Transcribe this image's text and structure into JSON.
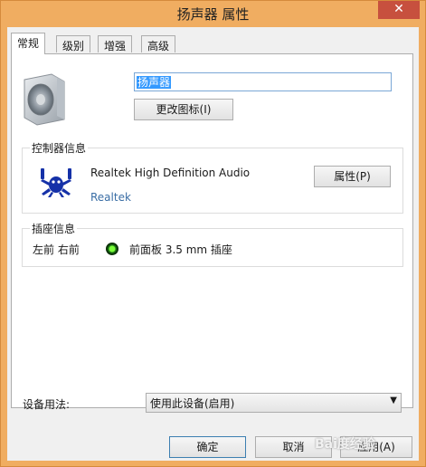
{
  "window": {
    "title": "扬声器 属性",
    "close_glyph": "✕"
  },
  "tabs": [
    {
      "label": "常规",
      "active": true
    },
    {
      "label": "级别",
      "active": false
    },
    {
      "label": "增强",
      "active": false
    },
    {
      "label": "高级",
      "active": false
    }
  ],
  "general": {
    "device_name": "扬声器",
    "change_icon_label": "更改图标(I)",
    "controller_group_label": "控制器信息",
    "controller_name": "Realtek High Definition Audio",
    "controller_vendor": "Realtek",
    "properties_button_label": "属性(P)",
    "jack_group_label": "插座信息",
    "jack_channels": "左前 右前",
    "jack_description": "前面板 3.5 mm 插座",
    "device_usage_label": "设备用法:",
    "device_usage_value": "使用此设备(启用)"
  },
  "buttons": {
    "ok": "确定",
    "cancel": "取消",
    "apply": "应用(A)"
  },
  "watermark": "Bai度经验",
  "colors": {
    "window_frame": "#f0ad61",
    "close_button": "#c7503e",
    "selection": "#3399ff",
    "realtek_blue": "#1531a8",
    "jack_green": "#2ea41f"
  }
}
